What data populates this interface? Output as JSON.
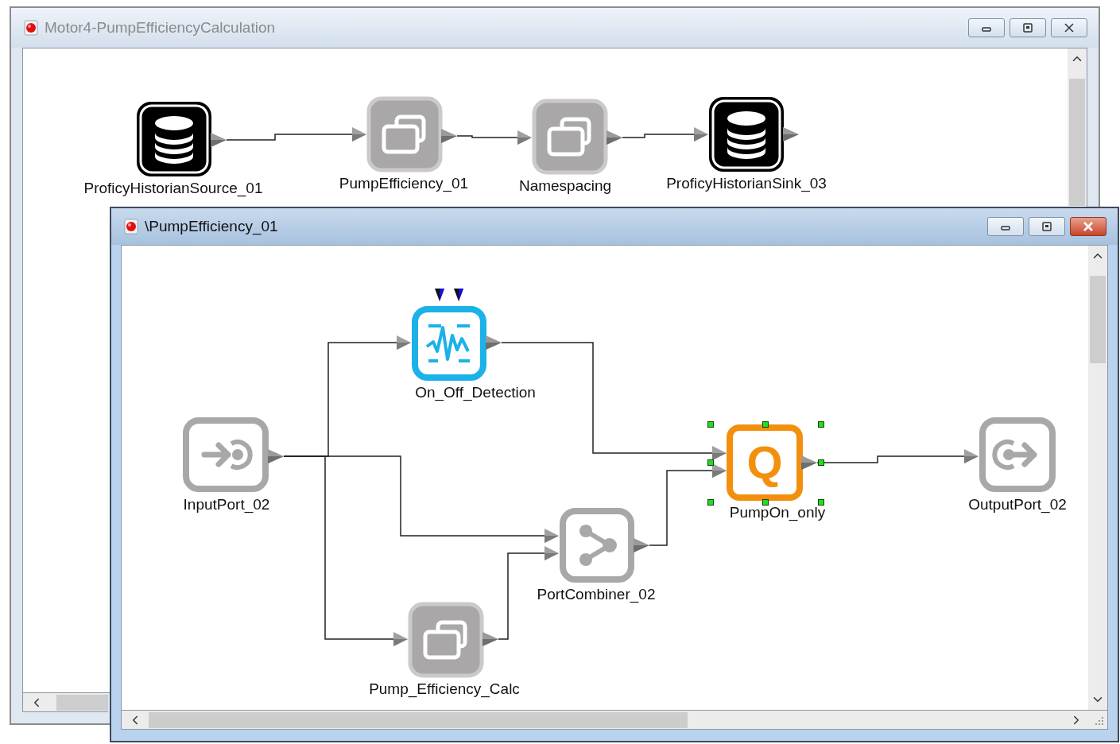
{
  "windows": [
    {
      "title": "Motor4-PumpEfficiencyCalculation",
      "active": false,
      "nodes": [
        {
          "label": "ProficyHistorianSource_01",
          "kind": "database",
          "selected": false
        },
        {
          "label": "PumpEfficiency_01",
          "kind": "component",
          "selected": false
        },
        {
          "label": "Namespacing",
          "kind": "component",
          "selected": false
        },
        {
          "label": "ProficyHistorianSink_03",
          "kind": "database",
          "selected": false
        }
      ]
    },
    {
      "title": "\\PumpEfficiency_01",
      "active": true,
      "nodes": [
        {
          "label": "On_Off_Detection",
          "kind": "detection",
          "selected": false
        },
        {
          "label": "InputPort_02",
          "kind": "input",
          "selected": false
        },
        {
          "label": "PumpOn_only",
          "kind": "query",
          "glyph": "Q",
          "selected": true
        },
        {
          "label": "OutputPort_02",
          "kind": "output",
          "selected": false
        },
        {
          "label": "PortCombiner_02",
          "kind": "combiner",
          "selected": false
        },
        {
          "label": "Pump_Efficiency_Calc",
          "kind": "component",
          "selected": false
        }
      ]
    }
  ]
}
